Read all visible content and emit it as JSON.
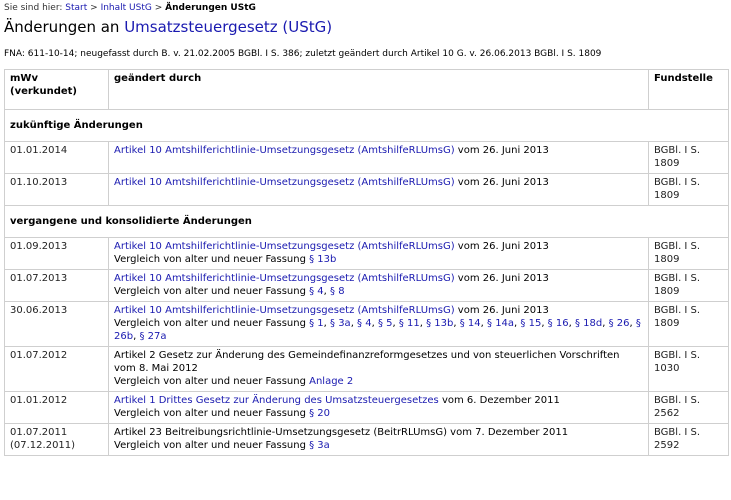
{
  "breadcrumb": {
    "prefix": "Sie sind hier:",
    "start": "Start",
    "sep": ">",
    "inhalt": "Inhalt UStG",
    "current": "Änderungen UStG"
  },
  "title": {
    "prefix": "Änderungen an ",
    "link": "Umsatzsteuergesetz (UStG)"
  },
  "fna": "FNA: 611-10-14; neugefasst durch B. v. 21.02.2005 BGBl. I S. 386; zuletzt geändert durch Artikel 10 G. v. 26.06.2013 BGBl. I S. 1809",
  "table": {
    "headers": {
      "c1_line1": "mWv",
      "c1_line2": "(verkundet)",
      "c2": "geändert durch",
      "c3": "Fundstelle"
    },
    "section_future": "zukünftige Änderungen",
    "section_past": "vergangene und konsolidierte Änderungen",
    "future": [
      {
        "date": "01.01.2014",
        "link": "Artikel 10 Amtshilferichtlinie-Umsetzungsgesetz (AmtshilfeRLUmsG)",
        "suffix": " vom 26. Juni 2013",
        "fund1": "BGBl. I S.",
        "fund2": "1809"
      },
      {
        "date": "01.10.2013",
        "link": "Artikel 10 Amtshilferichtlinie-Umsetzungsgesetz (AmtshilfeRLUmsG)",
        "suffix": " vom 26. Juni 2013",
        "fund1": "BGBl. I S.",
        "fund2": "1809"
      }
    ],
    "past": {
      "r1": {
        "date": "01.09.2013",
        "link": "Artikel 10 Amtshilferichtlinie-Umsetzungsgesetz (AmtshilfeRLUmsG)",
        "suffix": " vom 26. Juni 2013",
        "cmp": "Vergleich von alter und neuer Fassung ",
        "p1": "§ 13b",
        "fund1": "BGBl. I S.",
        "fund2": "1809"
      },
      "r2": {
        "date": "01.07.2013",
        "link": "Artikel 10 Amtshilferichtlinie-Umsetzungsgesetz (AmtshilfeRLUmsG)",
        "suffix": " vom 26. Juni 2013",
        "cmp": "Vergleich von alter und neuer Fassung ",
        "p1": "§ 4",
        "p2": "§ 8",
        "fund1": "BGBl. I S.",
        "fund2": "1809"
      },
      "r3": {
        "date": "30.06.2013",
        "link": "Artikel 10 Amtshilferichtlinie-Umsetzungsgesetz (AmtshilfeRLUmsG)",
        "suffix": " vom 26. Juni 2013",
        "cmp": "Vergleich von alter und neuer Fassung ",
        "paras": [
          "§ 1",
          "§ 3a",
          "§ 4",
          "§ 5",
          "§ 11",
          "§ 13b",
          "§ 14",
          "§ 14a",
          "§ 15",
          "§ 16",
          "§ 18d",
          "§ 26",
          "§ 26b",
          "§ 27a"
        ],
        "fund1": "BGBl. I S.",
        "fund2": "1809"
      },
      "r4": {
        "date": "01.07.2012",
        "text": "Artikel 2 Gesetz zur Änderung des Gemeindefinanzreformgesetzes und von steuerlichen Vorschriften vom 8. Mai 2012",
        "cmp": "Vergleich von alter und neuer Fassung ",
        "p1": "Anlage 2",
        "fund1": "BGBl. I S.",
        "fund2": "1030"
      },
      "r5": {
        "date": "01.01.2012",
        "link": "Artikel 1 Drittes Gesetz zur Änderung des Umsatzsteuergesetzes",
        "suffix": " vom 6. Dezember 2011",
        "cmp": "Vergleich von alter und neuer Fassung ",
        "p1": "§ 20",
        "fund1": "BGBl. I S.",
        "fund2": "2562"
      },
      "r6": {
        "date": "01.07.2011",
        "date2": "(07.12.2011)",
        "text": "Artikel 23 Beitreibungsrichtlinie-Umsetzungsgesetz (BeitrRLUmsG) vom 7. Dezember 2011",
        "cmp": "Vergleich von alter und neuer Fassung ",
        "p1": "§ 3a",
        "fund1": "BGBl. I S.",
        "fund2": "2592"
      }
    }
  }
}
